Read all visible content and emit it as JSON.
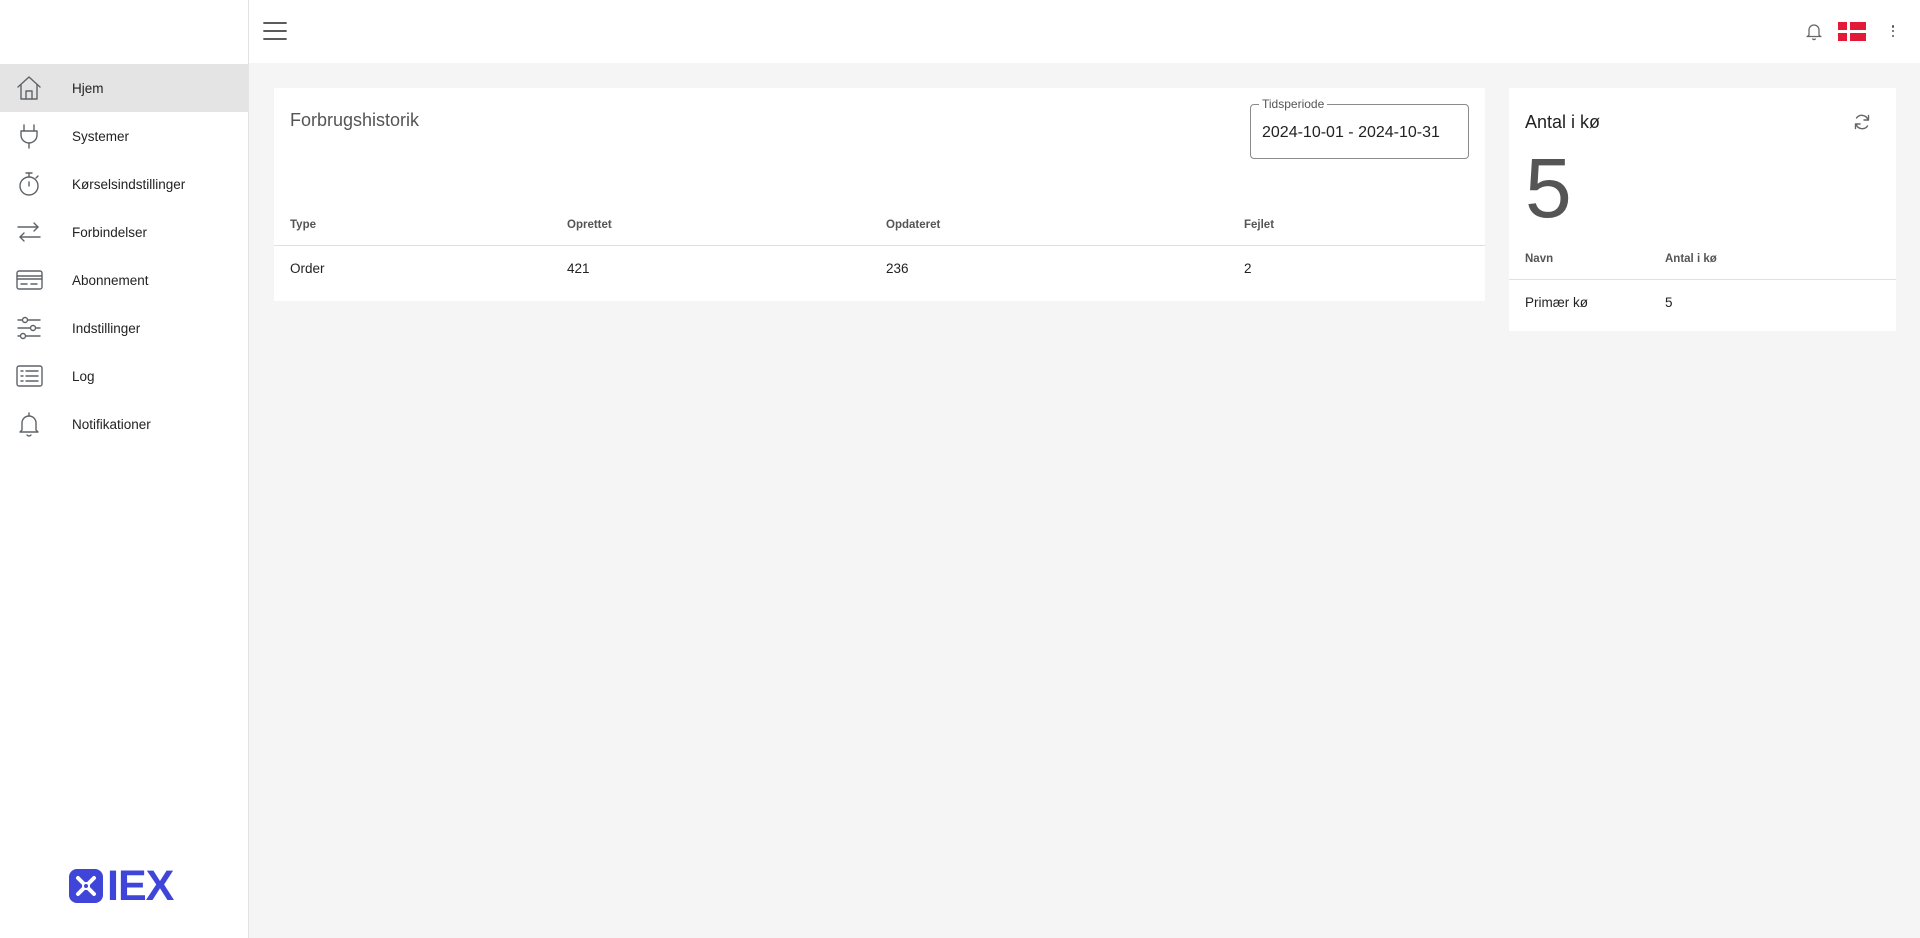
{
  "sidebar": {
    "items": [
      {
        "label": "Hjem",
        "icon": "home-icon",
        "active": true
      },
      {
        "label": "Systemer",
        "icon": "plug-icon",
        "active": false
      },
      {
        "label": "Kørselsindstillinger",
        "icon": "timer-icon",
        "active": false
      },
      {
        "label": "Forbindelser",
        "icon": "arrows-swap-icon",
        "active": false
      },
      {
        "label": "Abonnement",
        "icon": "credit-card-icon",
        "active": false
      },
      {
        "label": "Indstillinger",
        "icon": "sliders-icon",
        "active": false
      },
      {
        "label": "Log",
        "icon": "list-icon",
        "active": false
      },
      {
        "label": "Notifikationer",
        "icon": "bell-icon",
        "active": false
      }
    ],
    "logo_text": "IEX"
  },
  "topbar": {
    "menu_icon": "hamburger-menu-icon",
    "notification_icon": "bell-icon",
    "language_flag": "danish-flag-icon",
    "more_icon": "more-vertical-icon"
  },
  "usage": {
    "title": "Forbrugshistorik",
    "period_label": "Tidsperiode",
    "period_value": "2024-10-01 - 2024-10-31",
    "columns": [
      "Type",
      "Oprettet",
      "Opdateret",
      "Fejlet"
    ],
    "rows": [
      [
        "Order",
        "421",
        "236",
        "2"
      ]
    ]
  },
  "queue": {
    "title": "Antal i kø",
    "count": "5",
    "refresh_icon": "refresh-icon",
    "columns": [
      "Navn",
      "Antal i kø"
    ],
    "rows": [
      [
        "Primær kø",
        "5"
      ]
    ]
  },
  "colors": {
    "brand": "#3f45d9",
    "flag_red": "#e21a37",
    "active_nav": "#e4e4e4",
    "background": "#f5f5f5"
  }
}
